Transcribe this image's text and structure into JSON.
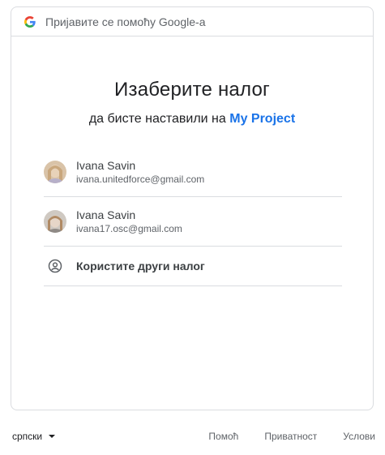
{
  "header": {
    "text": "Пријавите се помоћу Google-а",
    "logo_icon": "google-g-icon"
  },
  "main": {
    "title": "Изаберите налог",
    "subtitle_prefix": "да бисте наставили на",
    "project_name": "My Project",
    "project_color": "#1a73e8"
  },
  "accounts": [
    {
      "name": "Ivana Savin",
      "email": "ivana.unitedforce@gmail.com"
    },
    {
      "name": "Ivana Savin",
      "email": "ivana17.osc@gmail.com"
    }
  ],
  "other_account": {
    "label": "Користите други налог",
    "icon": "account-circle-icon"
  },
  "footer": {
    "language": "српски",
    "help": "Помоћ",
    "privacy": "Приватност",
    "terms": "Услови"
  }
}
